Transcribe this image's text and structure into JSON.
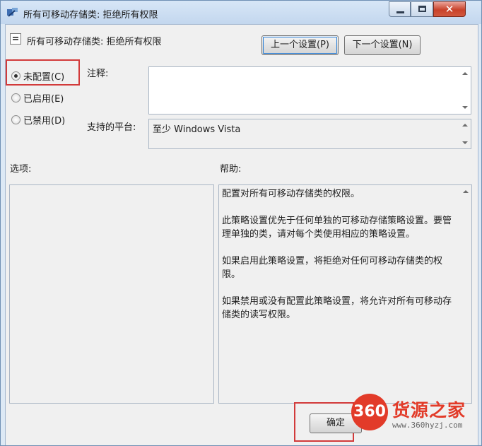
{
  "window": {
    "title": "所有可移动存储类: 拒绝所有权限",
    "controls": [
      "minimize-icon",
      "maximize-icon",
      "close-icon"
    ]
  },
  "policy": {
    "title": "所有可移动存储类: 拒绝所有权限",
    "prev_label": "上一个设置(P)",
    "next_label": "下一个设置(N)"
  },
  "state": {
    "options": [
      {
        "label": "未配置(C)",
        "selected": true
      },
      {
        "label": "已启用(E)",
        "selected": false
      },
      {
        "label": "已禁用(D)",
        "selected": false
      }
    ]
  },
  "comment": {
    "label": "注释:",
    "value": ""
  },
  "platform": {
    "label": "支持的平台:",
    "value": "至少 Windows Vista"
  },
  "options_pane": {
    "label": "选项:"
  },
  "help_pane": {
    "label": "帮助:",
    "text": "配置对所有可移动存储类的权限。\n\n此策略设置优先于任何单独的可移动存储策略设置。要管理单独的类，请对每个类使用相应的策略设置。\n\n如果启用此策略设置，将拒绝对任何可移动存储类的权限。\n\n如果禁用或没有配置此策略设置，将允许对所有可移动存储类的读写权限。"
  },
  "footer": {
    "ok_label": "确定"
  },
  "watermark": {
    "logo": "360",
    "name": "货源之家",
    "url": "www.360hyzj.com"
  },
  "colors": {
    "highlight_box": "#d23a3a",
    "watermark": "#e23b29"
  }
}
